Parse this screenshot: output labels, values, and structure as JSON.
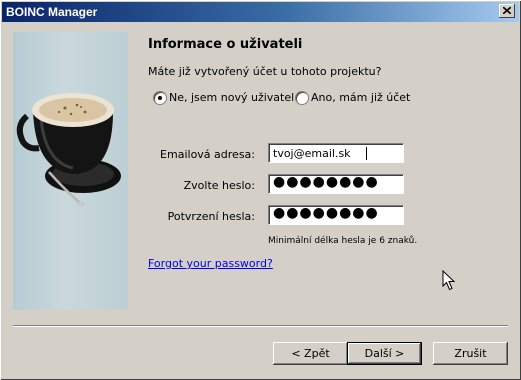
{
  "window": {
    "title": "BOINC Manager"
  },
  "page": {
    "heading": "Informace o uživateli",
    "question": "Máte již vytvořený účet u tohoto projektu?"
  },
  "account_choice": {
    "options": [
      {
        "label": "Ne, jsem nový uživatel",
        "checked": true
      },
      {
        "label": "Ano, mám již účet",
        "checked": false
      }
    ]
  },
  "form": {
    "email": {
      "label": "Emailová adresa:",
      "value": "tvoj@email.sk"
    },
    "password": {
      "label": "Zvolte heslo:",
      "value": "●●●●●●●●"
    },
    "confirm": {
      "label": "Potvrzení hesla:",
      "value": "●●●●●●●●"
    },
    "hint": "Minimální délka hesla je 6 znaků."
  },
  "links": {
    "forgot_password": "Forgot your password?"
  },
  "buttons": {
    "back": "< Zpět",
    "next": "Další >",
    "cancel": "Zrušit"
  },
  "icons": {
    "close": "close-icon",
    "illustration": "coffee-cup-illustration",
    "cursor": "mouse-pointer-icon"
  }
}
